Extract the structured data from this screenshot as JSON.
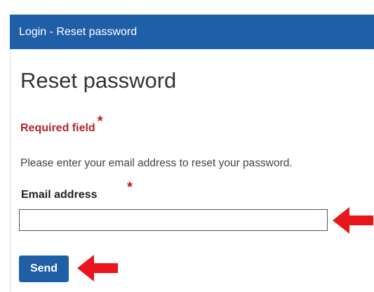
{
  "window": {
    "title": "Login - Reset password"
  },
  "form": {
    "heading": "Reset password",
    "required_note": "Required field",
    "required_marker": "*",
    "instructions": "Please enter your email address to reset your password.",
    "email": {
      "label": "Email address",
      "value": "",
      "placeholder": ""
    },
    "send_label": "Send"
  },
  "annotations": {
    "arrow_color": "#e8161b",
    "arrow_icon": "red-arrow-left"
  },
  "colors": {
    "accent": "#1f5fa8",
    "required": "#b0262a"
  }
}
